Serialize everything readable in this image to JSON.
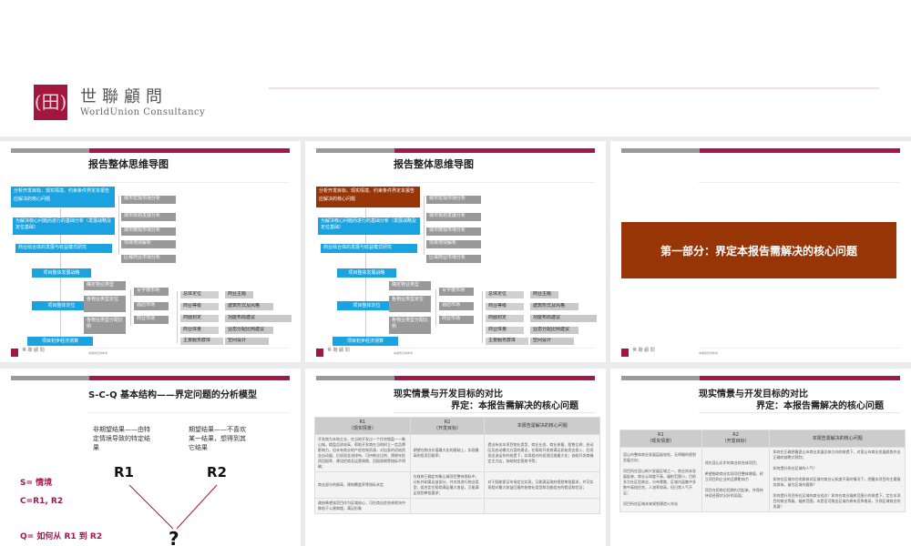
{
  "header": {
    "logo_cn": "世聯顧問",
    "logo_en": "WorldUnion Consultancy",
    "logo_mark": "(田)"
  },
  "mindmap": {
    "title": "报告整体思维导图",
    "steps": [
      "分析开发目标、现实情境、约束条件界定本报告应解决的核心问题",
      "为解决核心问题而进行的基础分析（发展战略及定位基础）",
      "商业综合体的发展与收益模式研究"
    ],
    "analysis": [
      "城市宏观市场分析",
      "城市规划发展分析",
      "城市微观市场分析",
      "项目地块解析",
      "区域商业市场分析"
    ],
    "stages": [
      "项目整体发展战略",
      "项目整体定位",
      "项目初步经济测算"
    ],
    "property": [
      "确定物业类型",
      "各物业类型定位",
      "各物业类型分配比例"
    ],
    "markets": [
      "写字楼市场",
      "酒店市场",
      "商业市场"
    ],
    "commerce_left": [
      "总体定位",
      "商业等级",
      "商圈划定",
      "商业体量",
      "主要服务群体"
    ],
    "commerce_right": [
      "商业主题",
      "建筑形式及风格",
      "功能布局建议",
      "业态分配比例建议",
      "空间设计"
    ]
  },
  "footer": {
    "logo_cn": "世 聯 顧 問",
    "logo_en": "WorldUnion Consultancy",
    "note": "本报告仅供参考"
  },
  "section": {
    "title": "第一部分：界定本报告需解决的核心问题"
  },
  "scq": {
    "title": "S-C-Q 基本结构——界定问题的分析模型",
    "r1_desc": "非期望结果——由特定情境导致的特定结果",
    "r2_desc": "期望结果——不喜欢某一结果，想得到其它结果",
    "r1": "R1",
    "r2": "R2",
    "s": "S= 情境",
    "c": "C=R1, R2",
    "q": "Q= 如何从 R1 到 R2",
    "mark": "?"
  },
  "compare": {
    "title": "现实情景与开发目标的对比",
    "subtitle": "界定：本报告需解决的核心问题",
    "headers": [
      "R1\n（现实情景）",
      "R2\n（开发目标）",
      "本报告需解决的核心问题"
    ],
    "table1": [
      [
        "开发商为本地企业，在当地开发过一个住宅楼盘——衡山城，楼盘品质较高，帮助开发商在当地树立一定品牌影响力，但未有商业地产经验和资源，对自身的初始资金自动量、后续现金流排布、可持物业比例、预期年投资回报率、建设招商及运营周期、回报周期等指标不明确；",
        "期望在物业价值最大化的基础上，实现最高的投资回报率；",
        "提出有关本项目物业类型、商业业态、商业体量、租售比例、启动区及启动模式方案的建议，在帮助开发商满足初始资金投入、后续现金流运作的前提下，实现相对的投资回报最大化；协助开发商确定主力店，协助制定招商书等；"
      ],
      [
        "商业部分的限高、建筑覆盖率等指标未定",
        "在政府已确定的衡山城项目整体指标中，分析并剥离出该部分，并对其进行物业类型、组合定位帮助满足最大收益，又能满足规划审批要求；",
        "对于既能保证市场定位实现，又能满足政府规划审批要求，并可实现相对最大收益回报的各物业类型和功能组合的假设和验证；"
      ],
      [
        "政府希望该项目作为区域核心，可在商业综合体地块中做若干公建商楼，满足形象",
        "",
        ""
      ]
    ],
    "table2": [
      [
        "昆山市整体商业发展层级较低，无明确的规划发展方向；\n\n项目所在昆山新兴发展区域之一，商业尚未发展起来，商业认知度不高，辐射范围小，目前多为社区型商业，分布零散，区域内虽集中多数中高档住宅，人流率较高，但日常人气不足；\n\n项目所在区域未来规划建造火车站",
        "领先昆山半步的商业综合体项目；\n\n希望借助商业实现项目整体增值，树立项目和企业的品牌影响力\n\n项目在招商后短期内活起来，并保持持续经营状况好的局面；",
        "如何在正确把握昆山市商业发展总体方向的前提下，对昆山市商业发展趋势作出正确的前瞻式预判；\n\n如何提升所在区域的人气？\n\n如何在区域内住宅群体对区域内商业认知度不高的情况下，把握本项目的主要服务群体，留住区域内客群？\n\n如何提升项目所在区域的商业档次？如何在商业辐射范围小的前提下，定位本项目的商业等级、辐射范围，本是否可跳出区域内原有竞争格局，引领区域商业的发展？"
      ]
    ]
  }
}
